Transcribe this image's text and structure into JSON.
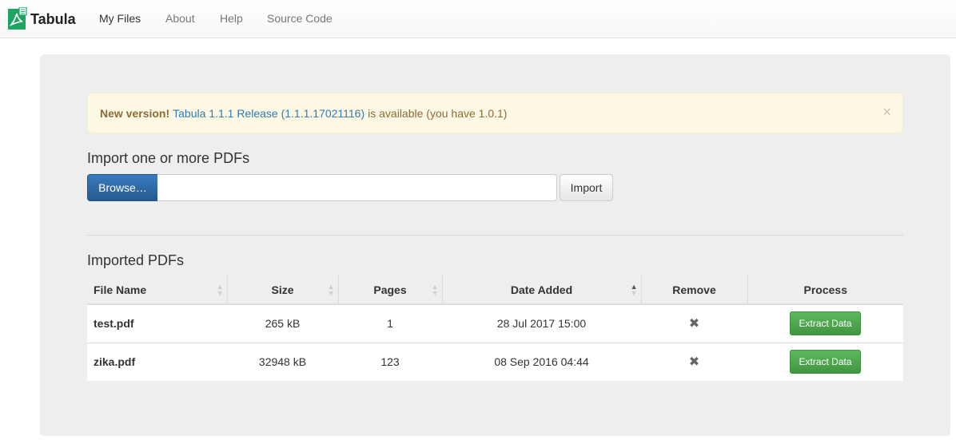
{
  "navbar": {
    "brand": "Tabula",
    "links": [
      "My Files",
      "About",
      "Help",
      "Source Code"
    ],
    "active": "My Files"
  },
  "alert": {
    "strong": "New version!",
    "link": "Tabula 1.1.1 Release (1.1.1.17021116)",
    "rest": "is available (you have 1.0.1)",
    "close": "×"
  },
  "import": {
    "title": "Import one or more PDFs",
    "browse_label": "Browse…",
    "file_value": "",
    "import_label": "Import"
  },
  "imported": {
    "title": "Imported PDFs",
    "columns": [
      "File Name",
      "Size",
      "Pages",
      "Date Added",
      "Remove",
      "Process"
    ],
    "rows": [
      {
        "file": "test.pdf",
        "size": "265 kB",
        "pages": "1",
        "date": "28 Jul 2017 15:00",
        "remove": "✖",
        "action": "Extract Data"
      },
      {
        "file": "zika.pdf",
        "size": "32948 kB",
        "pages": "123",
        "date": "08 Sep 2016 04:44",
        "remove": "✖",
        "action": "Extract Data"
      }
    ]
  },
  "colors": {
    "brand_green": "#1fa463",
    "primary_blue": "#265a8e",
    "success_green": "#47a447",
    "alert_bg": "#fcf8e3",
    "well_bg": "#eeeeee"
  },
  "icons": {
    "logo": "tabula-logo-icon",
    "sort": "sort-icon",
    "remove": "remove-icon",
    "close": "close-icon"
  }
}
